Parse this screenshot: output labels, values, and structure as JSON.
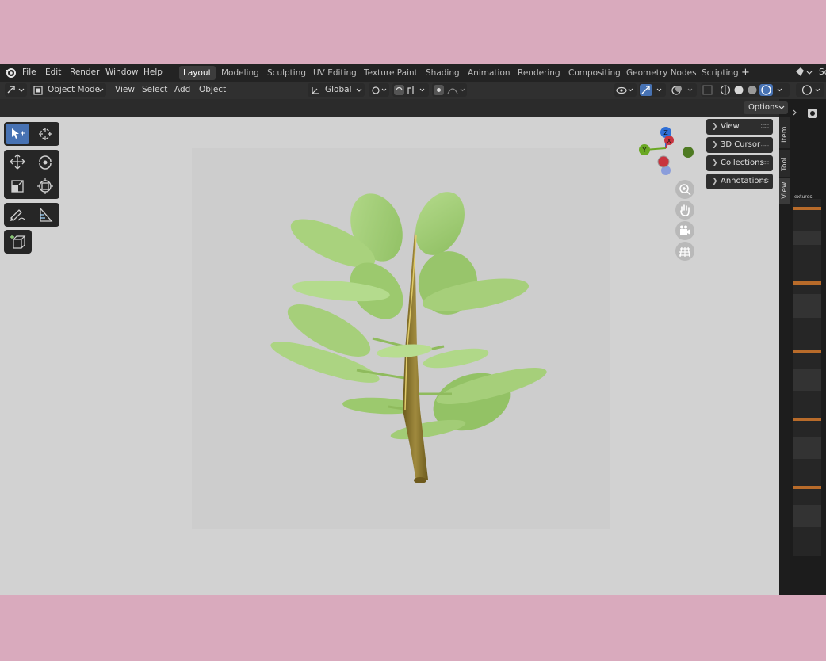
{
  "menu": {
    "items": [
      "File",
      "Edit",
      "Render",
      "Window",
      "Help"
    ]
  },
  "workspaces": {
    "tabs": [
      "Layout",
      "Modeling",
      "Sculpting",
      "UV Editing",
      "Texture Paint",
      "Shading",
      "Animation",
      "Rendering",
      "Compositing",
      "Geometry Nodes",
      "Scripting"
    ],
    "active": "Layout",
    "add_label": "+"
  },
  "scene_cut": "Sc",
  "toolbar": {
    "mode": "Object Mode",
    "view": "View",
    "select": "Select",
    "add": "Add",
    "object": "Object",
    "orientation": "Global"
  },
  "options_label": "Options",
  "npanel": {
    "sections": [
      "View",
      "3D Cursor",
      "Collections",
      "Annotations"
    ],
    "tabs": [
      "Item",
      "Tool",
      "View"
    ]
  },
  "gizmo": {
    "z": "Z",
    "y": "Y",
    "x": "X",
    "colors": {
      "z": "#2f6fd6",
      "y": "#6aa823",
      "x": "#c8343f"
    }
  },
  "side_panel_label": "extures",
  "colors": {
    "accent": "#4772b3",
    "background": "#d9aabd",
    "viewport": "#d2d2d2",
    "leaf": "#a6cf7a",
    "stem": "#8c7a2c"
  },
  "icons": {
    "tools": [
      "cursor-select-icon",
      "3d-cursor-icon",
      "move-icon",
      "rotate-icon",
      "scale-icon",
      "transform-icon",
      "annotate-icon",
      "measure-icon",
      "add-cube-icon"
    ],
    "nav": [
      "zoom-icon",
      "hand-pan-icon",
      "camera-icon",
      "grid-ortho-icon"
    ]
  }
}
